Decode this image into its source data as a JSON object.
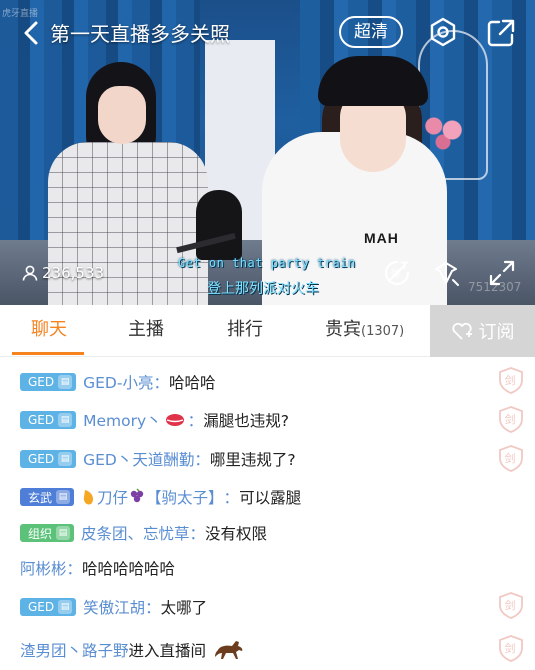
{
  "video": {
    "title": "第一天直播多多关照",
    "quality_label": "超清",
    "watermark": "虎牙直播",
    "viewer_count": "236,533",
    "subtitle_en": "Get on that party train",
    "subtitle_cn": "登上那列派对火车",
    "shirt_text": "MAH",
    "stream_id": "7512307"
  },
  "tabs": [
    {
      "label": "聊天"
    },
    {
      "label": "主播"
    },
    {
      "label": "排行"
    },
    {
      "label": "贵宾",
      "count": "(1307)"
    }
  ],
  "subscribe_label": "订阅",
  "chat": [
    {
      "badge": "GED",
      "badge_color": "#5eb3e6",
      "user": "GED-小亮",
      "sep": "：",
      "text": "哈哈哈",
      "text_color": "#222222"
    },
    {
      "badge": "GED",
      "badge_color": "#5eb3e6",
      "user": "Memory丶",
      "emoji": "lips",
      "sep": "：",
      "text": "漏腿也违规?",
      "text_color": "#222222"
    },
    {
      "badge": "GED",
      "badge_color": "#5eb3e6",
      "user": "GED丶天道酬勤",
      "sep": "：",
      "text": "哪里违规了?",
      "text_color": "#222222"
    },
    {
      "badge": "玄武",
      "badge_color": "#4f7ed8",
      "user": "刀仔",
      "decor": "【驹太子】",
      "sep": "：",
      "text": "可以露腿",
      "text_color": "#222222"
    },
    {
      "badge": "组织",
      "badge_color": "#5cc27a",
      "user": "皮条团、忘忧草",
      "sep": "：",
      "text": "没有权限",
      "text_color": "#222222"
    },
    {
      "user": "阿彬彬",
      "sep": "：",
      "text": "哈哈哈哈哈哈",
      "text_color": "#222222"
    },
    {
      "badge": "GED",
      "badge_color": "#5eb3e6",
      "user": "笑傲江胡",
      "sep": "：",
      "text": "太哪了",
      "text_color": "#222222"
    },
    {
      "user": "渣男团丶路子野",
      "text": " 进入直播间",
      "text_color": "#222222"
    }
  ],
  "colors": {
    "accent": "#f5831f",
    "username": "#5a8ed2",
    "subscribe_bg": "#d5d5d5",
    "subtitle": "#7ee0ff"
  },
  "icons": [
    "back-icon",
    "settings-icon",
    "share-icon",
    "person-icon",
    "danmaku-off-icon",
    "gift-icon",
    "fullscreen-icon",
    "heart-plus-icon",
    "sword-icon",
    "horse-icon",
    "lips-emoji",
    "mango-emoji",
    "grape-emoji"
  ]
}
